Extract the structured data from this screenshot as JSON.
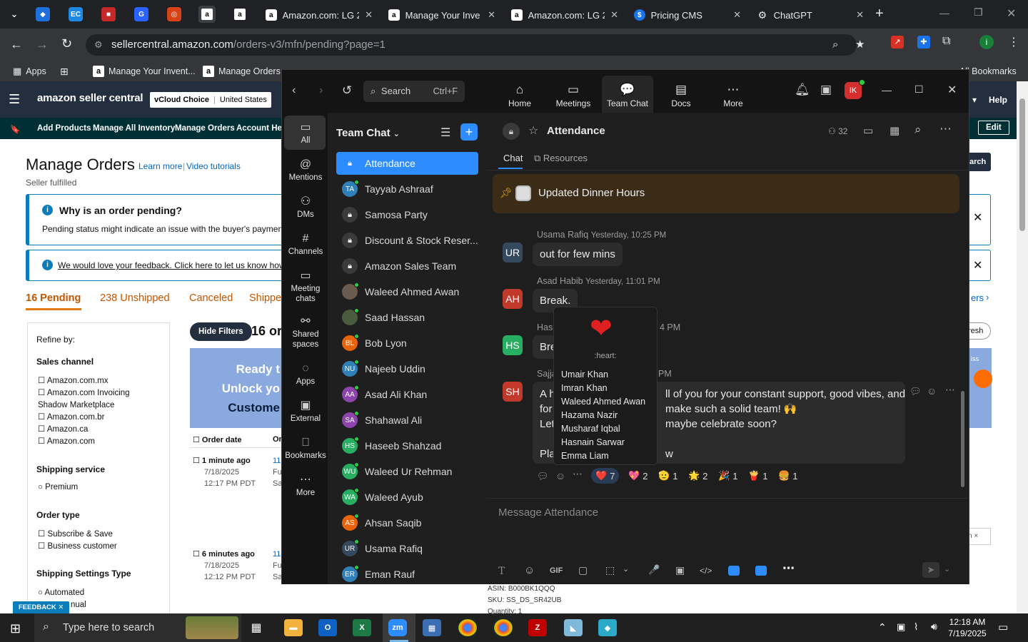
{
  "browser": {
    "tabs": [
      {
        "title": "Amazon.com: LG 2",
        "close": "✕"
      },
      {
        "title": "Manage Your Inve",
        "close": "✕"
      },
      {
        "title": "Amazon.com: LG 2",
        "close": "✕"
      },
      {
        "title": "Pricing CMS",
        "close": "✕"
      },
      {
        "title": "ChatGPT",
        "close": "✕"
      }
    ],
    "new_tab": "+",
    "url_host": "sellercentral.amazon.com",
    "url_path": "/orders-v3/mfn/pending?page=1",
    "bookmarks": [
      "Apps",
      "Manage Your Invent...",
      "Manage Orders"
    ],
    "all_bookmarks": "All Bookmarks",
    "profile_initial": "i"
  },
  "seller": {
    "logo": "amazon seller central",
    "store": "vCloud Choice",
    "region": "United States",
    "help": "Help",
    "nav": [
      "Add Products",
      "Manage All Inventory",
      "Manage Orders",
      "Account Heal"
    ],
    "edit": "Edit",
    "title": "Manage Orders",
    "learn_more": "Learn more",
    "video_tutorials": "Video tutorials",
    "subtitle": "Seller fulfilled",
    "pending_box": {
      "title": "Why is an order pending?",
      "body": "Pending status might indicate an issue with the buyer's payment m"
    },
    "feedback_link": "We would love your feedback. Click here to let us know how w",
    "tabs": [
      "16 Pending",
      "238 Unshipped",
      "Canceled",
      "Shippe"
    ],
    "filters_label": "ers",
    "refine_by": "Refine by:",
    "sales_channel": {
      "title": "Sales channel",
      "options": [
        "Amazon.com.mx",
        "Amazon.com Invoicing Shadow Marketplace",
        "Amazon.com.br",
        "Amazon.ca",
        "Amazon.com"
      ]
    },
    "shipping_service": {
      "title": "Shipping service",
      "options": [
        "Premium"
      ]
    },
    "order_type": {
      "title": "Order type",
      "options": [
        "Subscribe & Save",
        "Business customer"
      ]
    },
    "shipping_settings": {
      "title": "Shipping Settings Type",
      "options": [
        "Automated",
        "nual"
      ]
    },
    "hide_filters": "Hide Filters",
    "count": "16 or",
    "banner": [
      "Ready t",
      "Unlock yo",
      "Custome"
    ],
    "col_order_date": "Order date",
    "col_or": "Or",
    "orders": [
      {
        "age": "1 minute ago",
        "date": "7/18/2025",
        "time": "12:17 PM PDT",
        "num": "11",
        "c1": "Fu",
        "c2": "Sa"
      },
      {
        "age": "6 minutes ago",
        "date": "7/18/2025",
        "time": "12:12 PM PDT",
        "num": "11",
        "c1": "Fu",
        "c2": "Sa"
      }
    ],
    "search_btn": "arch",
    "refresh": "resh",
    "asin": "ASIN: B000BK1QQQ",
    "sku": "SKU: SS_DS_SR42UB",
    "qty": "Quantity: 1",
    "feedback_tab": "FEEDBACK ✕",
    "right_link": "n ×"
  },
  "zoom": {
    "search": "Search",
    "search_shortcut": "Ctrl+F",
    "top_nav": [
      "Home",
      "Meetings",
      "Team Chat",
      "Docs",
      "More"
    ],
    "user_initials": "IK",
    "rail": [
      "All",
      "Mentions",
      "DMs",
      "Channels",
      "Meeting chats",
      "Shared spaces",
      "Apps",
      "External",
      "Bookmarks",
      "More"
    ],
    "list_title": "Team Chat",
    "channels": [
      {
        "name": "Attendance",
        "initials": "",
        "color": "#2d8cff",
        "lock": true,
        "selected": true
      },
      {
        "name": "Tayyab Ashraaf",
        "initials": "TA",
        "color": "#2f7fb8",
        "lock": false
      },
      {
        "name": "Samosa Party",
        "initials": "",
        "color": "#3a3a3a",
        "lock": true
      },
      {
        "name": "Discount & Stock Reser...",
        "initials": "",
        "color": "#3a3a3a",
        "lock": true
      },
      {
        "name": "Amazon Sales Team",
        "initials": "",
        "color": "#3a3a3a",
        "lock": true
      },
      {
        "name": "Waleed Ahmed Awan",
        "initials": "",
        "color": "#6b5a4e",
        "lock": false,
        "photo": true
      },
      {
        "name": "Saad Hassan",
        "initials": "",
        "color": "#4b5b3e",
        "lock": false,
        "photo": true
      },
      {
        "name": "Bob Lyon",
        "initials": "BL",
        "color": "#e8630a",
        "lock": false
      },
      {
        "name": "Najeeb Uddin",
        "initials": "NU",
        "color": "#2f7fb8",
        "lock": false
      },
      {
        "name": "Asad Ali Khan",
        "initials": "AA",
        "color": "#8e44ad",
        "lock": false
      },
      {
        "name": "Shahawal Ali",
        "initials": "SA",
        "color": "#8e44ad",
        "lock": false
      },
      {
        "name": "Haseeb Shahzad",
        "initials": "HS",
        "color": "#27ae60",
        "lock": false
      },
      {
        "name": "Waleed Ur Rehman",
        "initials": "WU",
        "color": "#27ae60",
        "lock": false
      },
      {
        "name": "Waleed Ayub",
        "initials": "WA",
        "color": "#27ae60",
        "lock": false
      },
      {
        "name": "Ahsan Saqib",
        "initials": "AS",
        "color": "#e8630a",
        "lock": false
      },
      {
        "name": "Usama Rafiq",
        "initials": "UR",
        "color": "#34495e",
        "lock": false
      },
      {
        "name": "Eman Rauf",
        "initials": "ER",
        "color": "#2f7fb8",
        "lock": false
      }
    ],
    "channel_title": "Attendance",
    "member_count": "32",
    "tabs": [
      "Chat",
      "Resources"
    ],
    "pinned": "Updated Dinner Hours",
    "messages": [
      {
        "initials": "UR",
        "color": "#34495e",
        "name": "Usama Rafiq",
        "time": "Yesterday, 10:25 PM",
        "text": "out for few mins"
      },
      {
        "initials": "AH",
        "color": "#c0392b",
        "name": "Asad Habib",
        "time": "Yesterday, 11:01 PM",
        "text": "Break."
      },
      {
        "initials": "HS",
        "color": "#27ae60",
        "name": "Hasn",
        "time": "4 PM",
        "text": "Bre"
      },
      {
        "initials": "SH",
        "color": "#c0392b",
        "name": "Sajja",
        "time": "PM",
        "lines": [
          "A h",
          "for",
          "Let",
          "",
          "Pla"
        ]
      }
    ],
    "long_msg_tail": [
      "ll of you for your constant support, good vibes, and",
      "make such a solid team! 🙌",
      "maybe celebrate soon?",
      "",
      "w"
    ],
    "reactions": [
      {
        "emoji": "❤️",
        "count": "7"
      },
      {
        "emoji": "💖",
        "count": "2"
      },
      {
        "emoji": "🫡",
        "count": "1"
      },
      {
        "emoji": "🌟",
        "count": "2"
      },
      {
        "emoji": "🎉",
        "count": "1"
      },
      {
        "emoji": "🍟",
        "count": "1"
      },
      {
        "emoji": "🍔",
        "count": "1"
      }
    ],
    "tooltip": {
      "emoji": "❤",
      "code": ":heart:",
      "names": [
        "Umair Khan",
        "Imran Khan",
        "Waleed Ahmed Awan",
        "Hazama Nazir",
        "Musharaf Iqbal",
        "Hasnain Sarwar",
        "Emma Liam"
      ]
    },
    "composer_placeholder": "Message Attendance",
    "toolbar": [
      "T",
      "☺",
      "GIF",
      "▢",
      "⬚",
      "🎤",
      "▣",
      "</>"
    ]
  },
  "taskbar": {
    "search_placeholder": "Type here to search",
    "time": "12:18 AM",
    "date": "7/19/2025"
  },
  "colors": {
    "zoom_blue": "#2d8cff",
    "amazon_orange": "#e47911",
    "pinned_bg": "#3b2c17"
  }
}
